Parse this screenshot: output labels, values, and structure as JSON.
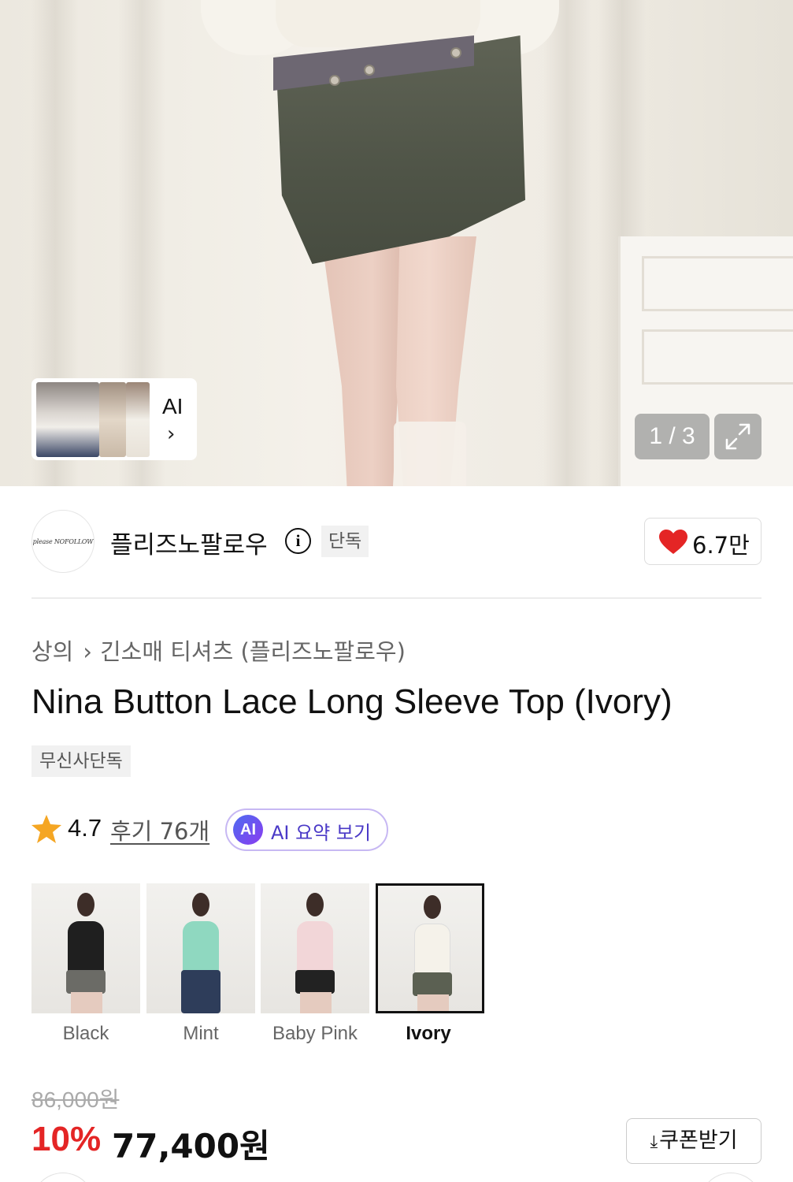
{
  "gallery": {
    "counter": "1 / 3",
    "ai_card_label": "AI",
    "ai_card_chevron": "›",
    "icons": {
      "expand": "expand-icon",
      "chevron": "chevron-right-icon"
    }
  },
  "brand": {
    "logo_text": "please NOFOLLOW",
    "name": "플리즈노팔로우",
    "info_symbol": "i",
    "exclusive_badge": "단독",
    "likes": "6.7만",
    "like_color": "#e42525"
  },
  "breadcrumb": {
    "category": "상의",
    "separator": "›",
    "subcategory": "긴소매 티셔츠 (플리즈노팔로우)"
  },
  "product": {
    "title": "Nina Button Lace Long Sleeve Top (Ivory)",
    "tag": "무신사단독"
  },
  "rating": {
    "score": "4.7",
    "reviews_link": "후기 76개",
    "ai_badge": "AI",
    "ai_summary_label": "AI 요약 보기",
    "star_color": "#f5a623"
  },
  "variants": [
    {
      "label": "Black",
      "top_color": "#1f1f1f",
      "bottom_color": "#6b6b66",
      "selected": false
    },
    {
      "label": "Mint",
      "top_color": "#8fd8c0",
      "bottom_color": "#2e3d5a",
      "selected": false
    },
    {
      "label": "Baby Pink",
      "top_color": "#f2d6d8",
      "bottom_color": "#222222",
      "selected": false
    },
    {
      "label": "Ivory",
      "top_color": "#f5f2ea",
      "bottom_color": "#5b6052",
      "selected": true
    }
  ],
  "price": {
    "original": "86,000원",
    "discount": "10%",
    "final": "77,400원",
    "coupon_label": "쿠폰받기",
    "coupon_icon": "⤓",
    "discount_color": "#e42525"
  }
}
